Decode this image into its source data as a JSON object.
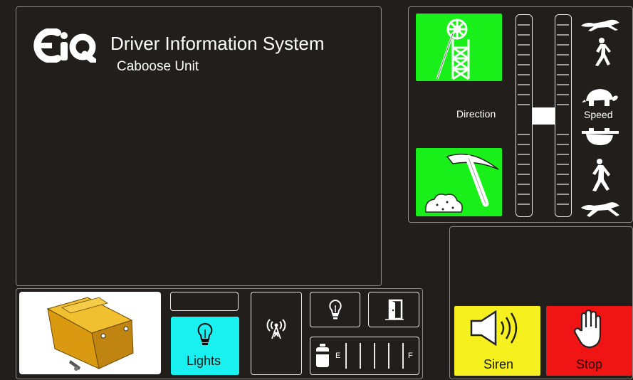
{
  "header": {
    "logo_text": "EiQ",
    "title": "Driver Information System",
    "subtitle": "Caboose Unit"
  },
  "direction": {
    "label": "Direction",
    "forward_icon": "mine-headframe-icon",
    "reverse_icon": "pickaxe-ore-icon",
    "level": 0.5
  },
  "speed": {
    "label": "Speed",
    "level": 0.5,
    "icons": [
      "cheetah-icon",
      "walking-person-icon",
      "tortoise-icon",
      "tortoise-icon",
      "walking-person-icon",
      "cheetah-icon"
    ]
  },
  "status_bar": {
    "vehicle_image": "caboose-vehicle-icon",
    "lights_label": "Lights",
    "radio_icon": "radio-antenna-icon",
    "bulb_icon": "lightbulb-icon",
    "door_icon": "door-icon",
    "fuel": {
      "icon": "fuel-tank-icon",
      "empty_label": "E",
      "full_label": "F",
      "level": 0
    }
  },
  "controls": {
    "siren_label": "Siren",
    "stop_label": "Stop"
  },
  "colors": {
    "background": "#211e1c",
    "green": "#19f019",
    "cyan": "#19f0f0",
    "yellow": "#f5f01e",
    "red": "#f01414",
    "vehicle_gold": "#e0a81c"
  }
}
